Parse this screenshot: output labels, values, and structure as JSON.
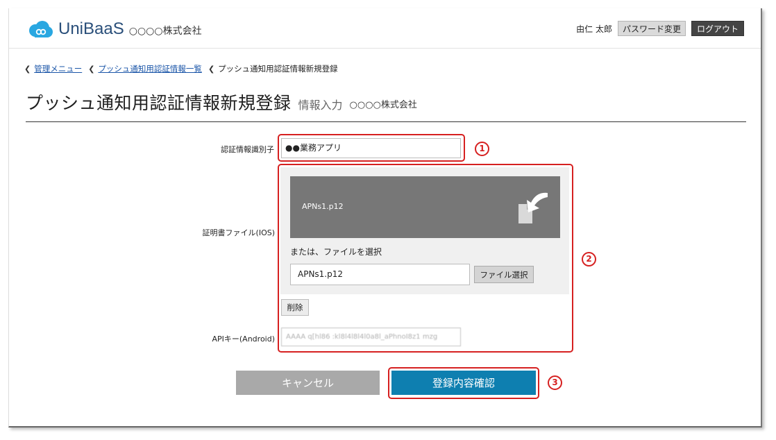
{
  "header": {
    "app_name": "UniBaaS",
    "company": "○○○○株式会社",
    "user_name": "由仁 太郎",
    "password_button": "パスワード変更",
    "logout_button": "ログアウト"
  },
  "breadcrumb": {
    "items": [
      "管理メニュー",
      "プッシュ通知用認証情報一覧"
    ],
    "current": "プッシュ通知用認証情報新規登録"
  },
  "page": {
    "title": "プッシュ通知用認証情報新規登録",
    "subtitle": "情報入力",
    "company": "○○○○株式会社"
  },
  "form": {
    "identifier_label": "認証情報識別子",
    "identifier_value": "●●業務アプリ",
    "cert_label": "証明書ファイル(IOS)",
    "drop_filename": "APNs1.p12",
    "or_select_text": "または、ファイルを選択",
    "file_input_value": "APNs1.p12",
    "file_select_button": "ファイル選択",
    "delete_button": "削除",
    "api_key_label": "APIキー(Android)",
    "api_key_value": "AAAA q[hl86 :kl8l4l8l4l0a8l_aPhnoI8z1 mzg"
  },
  "markers": [
    "1",
    "2",
    "3"
  ],
  "actions": {
    "cancel": "キャンセル",
    "confirm": "登録内容確認"
  },
  "colors": {
    "brand_blue": "#2a4f7a",
    "logo_icon": "#29a7e1",
    "confirm_button": "#0e7fb0",
    "cancel_button": "#a9a9a9",
    "highlight": "#d62020",
    "drop_zone": "#777777"
  },
  "icons": [
    "cloud-logo-icon",
    "file-drop-icon"
  ]
}
